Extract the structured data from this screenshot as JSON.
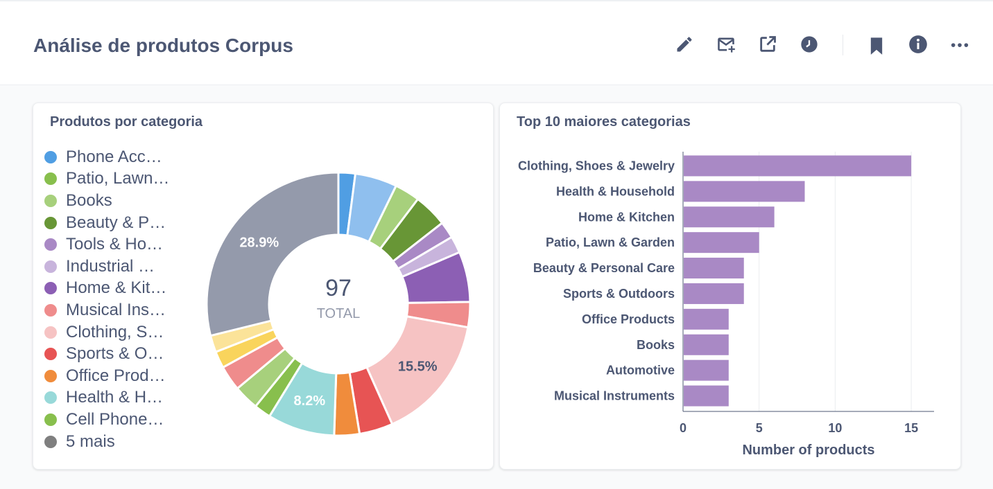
{
  "header": {
    "title": "Análise de produtos Corpus"
  },
  "toolbar": {
    "icons": [
      "pencil-icon",
      "mail-add-icon",
      "share-external-icon",
      "clock-icon",
      "bookmark-icon",
      "info-icon",
      "more-icon"
    ]
  },
  "colors": {
    "text": "#4c5773",
    "bar": "#a989c5",
    "muted": "#949aab"
  },
  "cards": {
    "donut": {
      "title": "Produtos por categoria",
      "total_value": "97",
      "total_label": "TOTAL",
      "legend": [
        {
          "label": "Phone Acc…",
          "color": "#509ee3"
        },
        {
          "label": "Patio, Lawn…",
          "color": "#88bf4d"
        },
        {
          "label": "Books",
          "color": "#a7d07c"
        },
        {
          "label": "Beauty & P…",
          "color": "#689636"
        },
        {
          "label": "Tools & Ho…",
          "color": "#a989c5"
        },
        {
          "label": "Industrial …",
          "color": "#c8b4dc"
        },
        {
          "label": "Home & Kit…",
          "color": "#8c5fb4"
        },
        {
          "label": "Musical Ins…",
          "color": "#ef8c8c"
        },
        {
          "label": "Clothing, S…",
          "color": "#f6c3c3"
        },
        {
          "label": "Sports & O…",
          "color": "#e75454"
        },
        {
          "label": "Office Prod…",
          "color": "#f08c3c"
        },
        {
          "label": "Health & H…",
          "color": "#98d9d9"
        },
        {
          "label": "Cell Phone…",
          "color": "#88bf4d"
        },
        {
          "label": "5 mais",
          "color": "#7f7f7f"
        }
      ]
    },
    "bars": {
      "title": "Top 10 maiores categorias"
    }
  },
  "chart_data": [
    {
      "type": "pie",
      "title": "Produtos por categoria",
      "total": 97,
      "slices": [
        {
          "label": "Phone Acc…",
          "value": 2,
          "color": "#509ee3"
        },
        {
          "label": "Patio, Lawn…",
          "value": 5,
          "color": "#8fbfee"
        },
        {
          "label": "Books",
          "value": 3,
          "color": "#a7d07c"
        },
        {
          "label": "Beauty & P…",
          "value": 4,
          "color": "#689636"
        },
        {
          "label": "Tools & Ho…",
          "value": 2,
          "color": "#a989c5"
        },
        {
          "label": "Industrial …",
          "value": 2,
          "color": "#c8b4dc"
        },
        {
          "label": "Home & Kit…",
          "value": 6,
          "color": "#8c5fb4"
        },
        {
          "label": "Musical Ins…",
          "value": 3,
          "color": "#ef8c8c"
        },
        {
          "label": "Clothing, S…",
          "value": 15,
          "color": "#f6c3c3"
        },
        {
          "label": "Sports & O…",
          "value": 4,
          "color": "#e75454"
        },
        {
          "label": "Office Prod…",
          "value": 3,
          "color": "#f08c3c"
        },
        {
          "label": "Health & H…",
          "value": 8,
          "color": "#98d9d9"
        },
        {
          "label": "Cell Phone…",
          "value": 2,
          "color": "#88bf4d"
        },
        {
          "label": "",
          "value": 3,
          "color": "#a7d07c"
        },
        {
          "label": "",
          "value": 3,
          "color": "#ef8c8c"
        },
        {
          "label": "",
          "value": 2,
          "color": "#f9d45c"
        },
        {
          "label": "",
          "value": 2,
          "color": "#fbe399"
        },
        {
          "label": "5 mais",
          "value": 28,
          "color": "#949aab"
        }
      ],
      "slice_labels": [
        "28.9%",
        "15.5%",
        "8.2%"
      ]
    },
    {
      "type": "bar",
      "orientation": "horizontal",
      "title": "Top 10 maiores categorias",
      "xlabel": "Number of products",
      "ylabel": "",
      "categories": [
        "Clothing, Shoes & Jewelry",
        "Health & Household",
        "Home & Kitchen",
        "Patio, Lawn & Garden",
        "Beauty & Personal Care",
        "Sports & Outdoors",
        "Office Products",
        "Books",
        "Automotive",
        "Musical Instruments"
      ],
      "values": [
        15,
        8,
        6,
        5,
        4,
        4,
        3,
        3,
        3,
        3
      ],
      "xlim": [
        0,
        16.5
      ],
      "xticks": [
        0,
        5,
        10,
        15
      ],
      "grid": true
    }
  ]
}
